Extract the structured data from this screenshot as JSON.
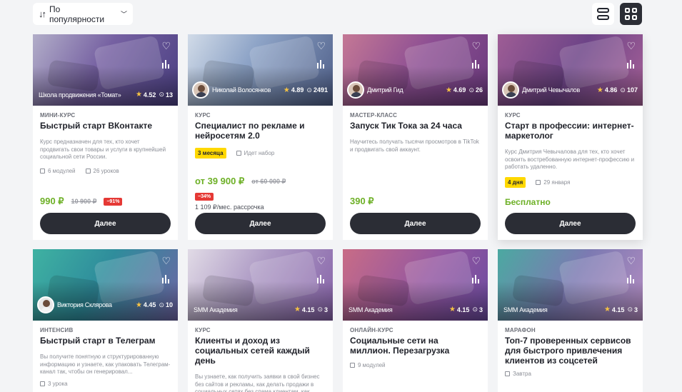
{
  "toolbar": {
    "sort_label": "По популярности",
    "sort_icon": "sort-icon",
    "view_list_icon": "list-view-icon",
    "view_grid_icon": "grid-view-icon"
  },
  "colors": {
    "accent_price": "#6db026",
    "button": "#2b2d35",
    "badge_yellow": "#ffd800",
    "discount_red": "#e53935"
  },
  "cards": [
    {
      "author": "Школа продвижения «Томат»",
      "rating": "4.52",
      "views": "13",
      "type": "МИНИ-КУРС",
      "title": "Быстрый старт ВКонтакте",
      "desc": "Курс предназначен для тех, кто хочет продвигать свои товары и услуги в крупнейшей социальной сети России.",
      "modules": "6 модулей",
      "lessons": "26 уроков",
      "price": "990 ₽",
      "old_price": "10 900 ₽",
      "discount": "−91%",
      "button": "Далее"
    },
    {
      "author": "Николай Волосянков",
      "rating": "4.89",
      "views": "2491",
      "type": "КУРС",
      "title": "Специалист по рекламе и нейросетям 2.0",
      "duration": "3 месяца",
      "status": "Идет набор",
      "price": "от 39 900 ₽",
      "old_price": "от 60 000 ₽",
      "discount": "−34%",
      "installment": "1 109 ₽/мес. рассрочка",
      "button": "Далее"
    },
    {
      "author": "Дмитрий Гид",
      "rating": "4.69",
      "views": "26",
      "type": "МАСТЕР-КЛАСС",
      "title": "Запуск Тик Тока за 24 часа",
      "desc": "Научитесь получать тысячи просмотров в TikTok и продвигать свой аккаунт.",
      "price": "390 ₽",
      "button": "Далее"
    },
    {
      "author": "Дмитрий Чевычалов",
      "rating": "4.86",
      "views": "107",
      "type": "КУРС",
      "title": "Старт в профессии: интернет-маркетолог",
      "desc": "Курс Дмитрия Чевычалова для тех, кто хочет освоить востребованную интернет-профессию и работать удаленно.",
      "duration": "4 дня",
      "date": "29 января",
      "price": "Бесплатно",
      "button": "Далее"
    },
    {
      "author": "Виктория Склярова",
      "rating": "4.45",
      "views": "10",
      "type": "ИНТЕНСИВ",
      "title": "Быстрый старт в Телеграм",
      "desc": "Вы получите понятную и структурированную информацию и узнаете, как упаковать Телеграм-канал так, чтобы он генерировал...",
      "lessons": "3 урока"
    },
    {
      "author": "SMM Академия",
      "rating": "4.15",
      "views": "3",
      "type": "КУРС",
      "title": "Клиенты и доход из социальных сетей каждый день",
      "desc": "Вы узнаете, как получить заявки в свой бизнес без сайтов и рекламы, как делать продажи в социальных сетях без спама клиентам, как"
    },
    {
      "author": "SMM Академия",
      "rating": "4.15",
      "views": "3",
      "type": "ОНЛАЙН-КУРС",
      "title": "Социальные сети на миллион. Перезагрузка",
      "modules": "9 модулей"
    },
    {
      "author": "SMM Академия",
      "rating": "4.15",
      "views": "3",
      "type": "МАРАФОН",
      "title": "Топ-7 проверенных сервисов для быстрого привлечения клиентов из соцсетей",
      "date": "Завтра"
    }
  ]
}
